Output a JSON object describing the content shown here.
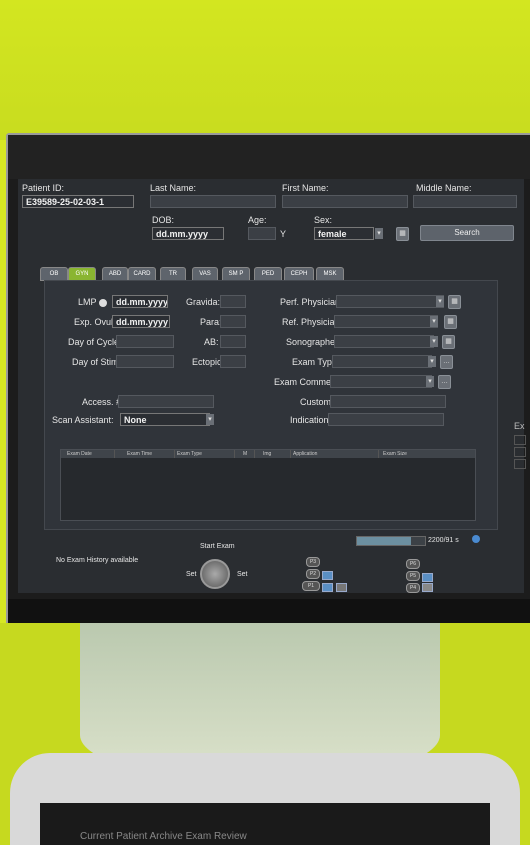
{
  "patient": {
    "id_label": "Patient ID:",
    "id_value": "E39589-25-02-03-1",
    "last_name_label": "Last Name:",
    "first_name_label": "First Name:",
    "middle_name_label": "Middle Name:",
    "dob_label": "DOB:",
    "dob_value": "dd.mm.yyyy",
    "age_label": "Age:",
    "age_unit": "Y",
    "sex_label": "Sex:",
    "sex_value": "female",
    "search_label": "Search"
  },
  "tabs": [
    "OB",
    "GYN",
    "ABD",
    "CARD",
    "TR",
    "VAS",
    "SM P",
    "PED",
    "CEPH",
    "MSK"
  ],
  "active_tab": "GYN",
  "gyn": {
    "lmp_label": "LMP",
    "lmp_value": "dd.mm.yyyy",
    "exp_ovul_label": "Exp. Ovul.",
    "exp_ovul_value": "dd.mm.yyyy",
    "day_of_cycle_label": "Day of Cycle",
    "day_of_stim_label": "Day of Stim.",
    "gravida_label": "Gravida:",
    "para_label": "Para:",
    "ab_label": "AB:",
    "ectopic_label": "Ectopic:"
  },
  "exam": {
    "perf_physician_label": "Perf. Physician:",
    "ref_physician_label": "Ref. Physician:",
    "sonographer_label": "Sonographer:",
    "exam_type_label": "Exam Type:",
    "exam_comment_label": "Exam Comment:",
    "custom_label": "Custom:",
    "indication_label": "Indication:",
    "access_label": "Access. #:",
    "scan_assistant_label": "Scan Assistant:",
    "scan_assistant_value": "None"
  },
  "table": {
    "columns": [
      "Exam Date",
      "Exam Time",
      "Exam Type",
      "M",
      "Img",
      "Application",
      "Exam Size"
    ]
  },
  "status": {
    "no_history": "No Exam History available",
    "storage": "2200/91 s",
    "storage_fraction": 0.8,
    "start_exam": "Start Exam",
    "set_left": "Set",
    "set_right": "Set",
    "side_label": "Ex"
  },
  "keys": {
    "p3": "P3",
    "p2": "P2",
    "p1": "P1",
    "p4": "P4",
    "p5": "P5",
    "p6": "P6"
  },
  "lower": {
    "device_text": "Current Patient   Archive   Exam Review"
  }
}
